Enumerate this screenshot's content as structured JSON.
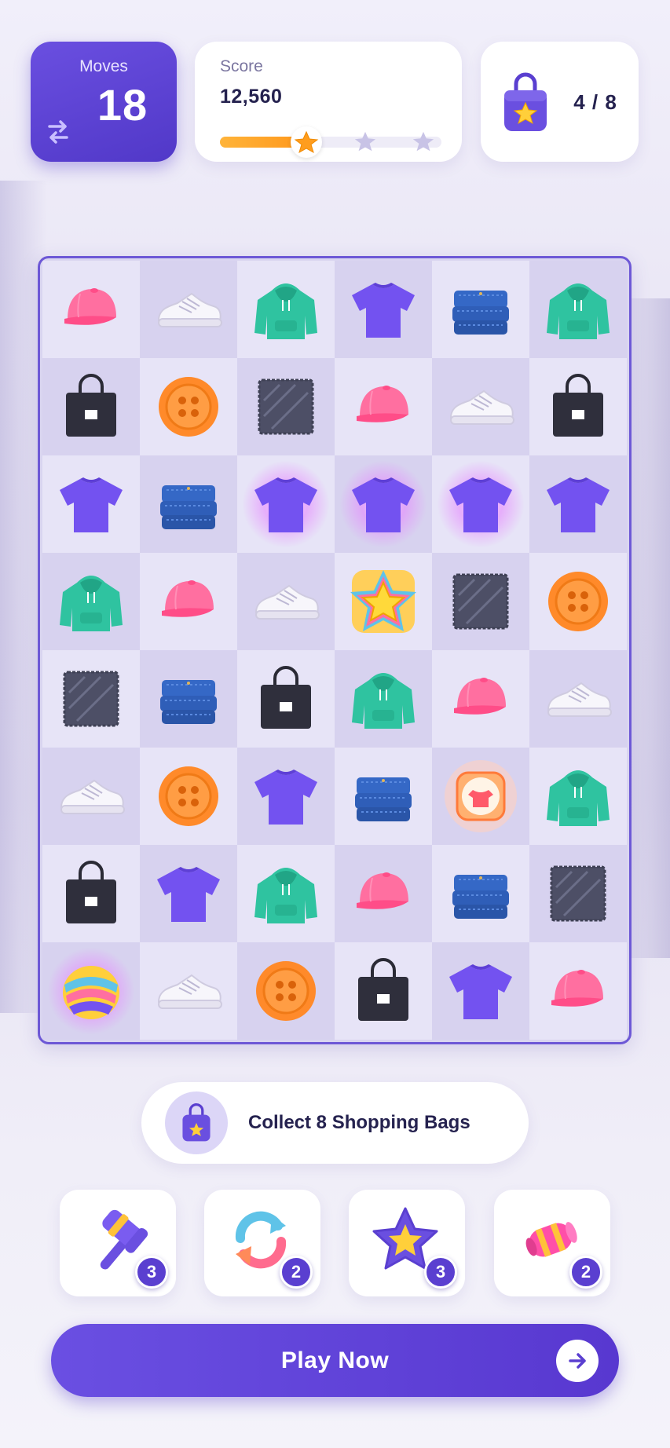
{
  "hud": {
    "moves_label": "Moves",
    "moves_value": "18",
    "score_label": "Score",
    "score_value": "12,560",
    "score_progress": 0.35,
    "stars_earned": 1,
    "stars_total": 3,
    "goal_count": "4 / 8"
  },
  "board": {
    "columns": 6,
    "rows": 8,
    "tiles": [
      [
        "cap",
        "sneaker",
        "hoodie",
        "tshirt",
        "jeans",
        "hoodie"
      ],
      [
        "bag",
        "button",
        "fabric",
        "cap",
        "sneaker",
        "bag"
      ],
      [
        "tshirt",
        "jeans",
        "tshirt",
        "tshirt",
        "tshirt",
        "tshirt"
      ],
      [
        "hoodie",
        "cap",
        "sneaker",
        "star-special",
        "fabric",
        "button"
      ],
      [
        "fabric",
        "jeans",
        "bag",
        "hoodie",
        "cap",
        "sneaker"
      ],
      [
        "sneaker",
        "button",
        "tshirt",
        "jeans",
        "burst-special",
        "hoodie"
      ],
      [
        "bag",
        "tshirt",
        "hoodie",
        "cap",
        "jeans",
        "fabric"
      ],
      [
        "rainbow-special",
        "sneaker",
        "button",
        "bag",
        "tshirt",
        "cap"
      ]
    ],
    "highlighted": [
      [
        2,
        2
      ],
      [
        2,
        3
      ],
      [
        2,
        4
      ]
    ]
  },
  "objective": {
    "text": "Collect 8 Shopping Bags",
    "icon": "shopping-bag-icon"
  },
  "boosters": [
    {
      "name": "hammer",
      "icon": "hammer-icon",
      "count": "3"
    },
    {
      "name": "shuffle",
      "icon": "shuffle-icon",
      "count": "2"
    },
    {
      "name": "star",
      "icon": "star-icon",
      "count": "3"
    },
    {
      "name": "rocket",
      "icon": "rocket-icon",
      "count": "2"
    }
  ],
  "play_button": {
    "label": "Play Now",
    "icon": "arrow-right-icon"
  },
  "colors": {
    "primary": "#5b3fd4",
    "accent_orange": "#ff9f22",
    "board_border": "#6d58d6",
    "text_dark": "#25224f"
  }
}
